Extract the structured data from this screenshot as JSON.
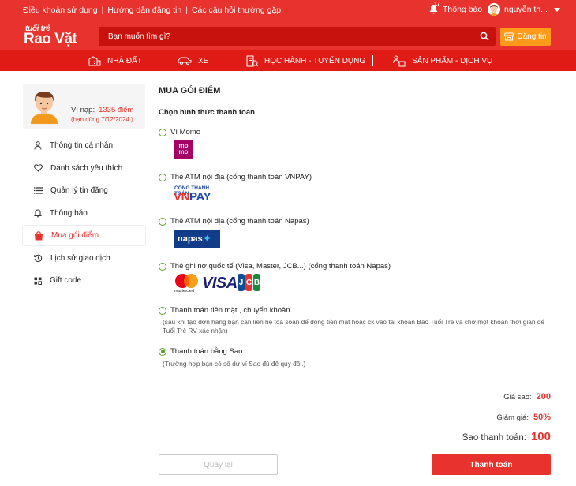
{
  "topbar": {
    "links": [
      "Điều khoản sử dụng",
      "Hướng dẫn đăng tin",
      "Các câu hỏi thường gặp"
    ],
    "separator": "|",
    "notification_count": "17",
    "notification_label": "Thông báo",
    "user_name": "nguyễn th..."
  },
  "brand": {
    "line1": "tuổi trẻ",
    "line2": "Rao Vặt"
  },
  "search": {
    "placeholder": "Bạn muốn tìm gì?"
  },
  "post_button": "Đăng tin",
  "categories": [
    "NHÀ ĐẤT",
    "XE",
    "HỌC HÀNH - TUYỂN DỤNG",
    "SẢN PHẨM - DỊCH VỤ"
  ],
  "profile": {
    "wallet_label": "Ví nạp:",
    "wallet_points": "1335 điểm",
    "expiry": "(hạn dùng 7/12/2024 )"
  },
  "sidebar_items": [
    {
      "label": "Thông tin cá nhân",
      "icon": "user-icon"
    },
    {
      "label": "Danh sách yêu thích",
      "icon": "heart-icon"
    },
    {
      "label": "Quản lý tin đăng",
      "icon": "list-icon"
    },
    {
      "label": "Thông báo",
      "icon": "bell-icon"
    },
    {
      "label": "Mua gói điểm",
      "icon": "shopping-bag-icon",
      "active": true
    },
    {
      "label": "Lịch sử giao dịch",
      "icon": "history-icon"
    },
    {
      "label": "Gift code",
      "icon": "grid-icon"
    }
  ],
  "main": {
    "title": "MUA GÓI ĐIỂM",
    "subtitle": "Chọn hình thức thanh toán",
    "options": [
      {
        "label": "Ví Momo",
        "selected": false
      },
      {
        "label": "Thẻ ATM nội địa (cổng thanh toán VNPAY)",
        "selected": false
      },
      {
        "label": "Thẻ ATM nội địa (cổng thanh toán Napas)",
        "selected": false
      },
      {
        "label": "Thẻ ghi nợ quốc tế (Visa, Master, JCB...) (cổng thanh toán Napas)",
        "selected": false
      },
      {
        "label": "Thanh toán tiền mặt , chuyển khoản",
        "selected": false,
        "note": "(sau khi tạo đơn hàng bạn cần liên hệ tòa soạn để đóng tiền mặt hoặc ck vào tài khoản Báo Tuổi Trẻ và chờ một khoản thời gian để Tuổi Trẻ RV xác nhận)"
      },
      {
        "label": "Thanh toán bằng Sao",
        "selected": true,
        "note": "(Trường hợp bạn có số dư ví Sao đủ để quy đổi.)"
      }
    ],
    "logos": {
      "momo": "mo mo",
      "vnpay_top": "CỔNG THANH TOÁN",
      "vnpay_vn": "VN",
      "vnpay_pay": "PAY",
      "napas": "napas",
      "mastercard": "mastercard",
      "visa": "VISA",
      "jcb": [
        "J",
        "C",
        "B"
      ]
    },
    "summary": {
      "price_label": "Giá sao:",
      "price_value": "200",
      "discount_label": "Giảm giá:",
      "discount_value": "50%",
      "total_label": "Sao thanh toán:",
      "total_value": "100"
    },
    "back_button": "Quay lại",
    "pay_button": "Thanh toán"
  },
  "colors": {
    "brand_red": "#e8322d",
    "accent_orange": "#ff9b1a",
    "radio_green": "#5a9e2e"
  }
}
